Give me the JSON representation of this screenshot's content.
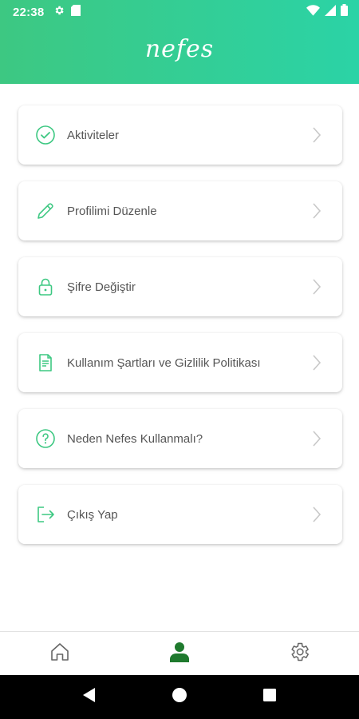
{
  "status_bar": {
    "time": "22:38",
    "left_icons": [
      "gear-icon",
      "sd-card-icon"
    ],
    "right_icons": [
      "wifi-icon",
      "cell-signal-icon",
      "battery-icon"
    ]
  },
  "app": {
    "brand": "nefes",
    "accent_color": "#3dc882",
    "header_gradient": [
      "#3dc882",
      "#2bd3a6"
    ]
  },
  "menu": {
    "items": [
      {
        "label": "Aktiviteler",
        "icon": "check-circle-icon"
      },
      {
        "label": "Profilimi Düzenle",
        "icon": "pencil-icon"
      },
      {
        "label": "Şifre Değiştir",
        "icon": "lock-icon"
      },
      {
        "label": "Kullanım Şartları ve Gizlilik Politikası",
        "icon": "document-icon"
      },
      {
        "label": "Neden Nefes Kullanmalı?",
        "icon": "question-circle-icon"
      },
      {
        "label": "Çıkış Yap",
        "icon": "logout-icon"
      }
    ]
  },
  "bottom_nav": {
    "items": [
      {
        "icon": "home-icon",
        "active": false
      },
      {
        "icon": "user-icon",
        "active": true
      },
      {
        "icon": "settings-icon",
        "active": false
      }
    ],
    "active_color": "#1f7a2e"
  },
  "system_nav": {
    "buttons": [
      "back-icon",
      "home-circle-icon",
      "recents-icon"
    ]
  }
}
